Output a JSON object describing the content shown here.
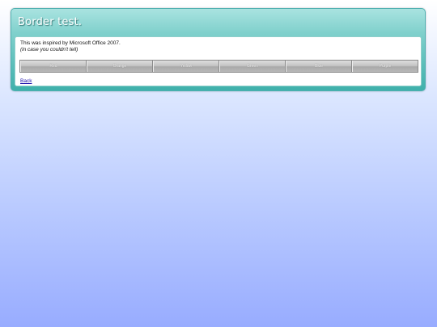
{
  "page": {
    "title": "Border test.",
    "intro_line1": "This was inspired by Microsoft Office 2007.",
    "intro_line2": "(in case you couldn't tell)",
    "back_label": "Back"
  },
  "buttons": [
    "Red",
    "Orange",
    "Yellow",
    "Green",
    "Blue",
    "Purple"
  ],
  "colors": {
    "header_teal": "#3fb0ab",
    "button_gray": "#bdbdbd",
    "background_blue": "#98acff"
  }
}
